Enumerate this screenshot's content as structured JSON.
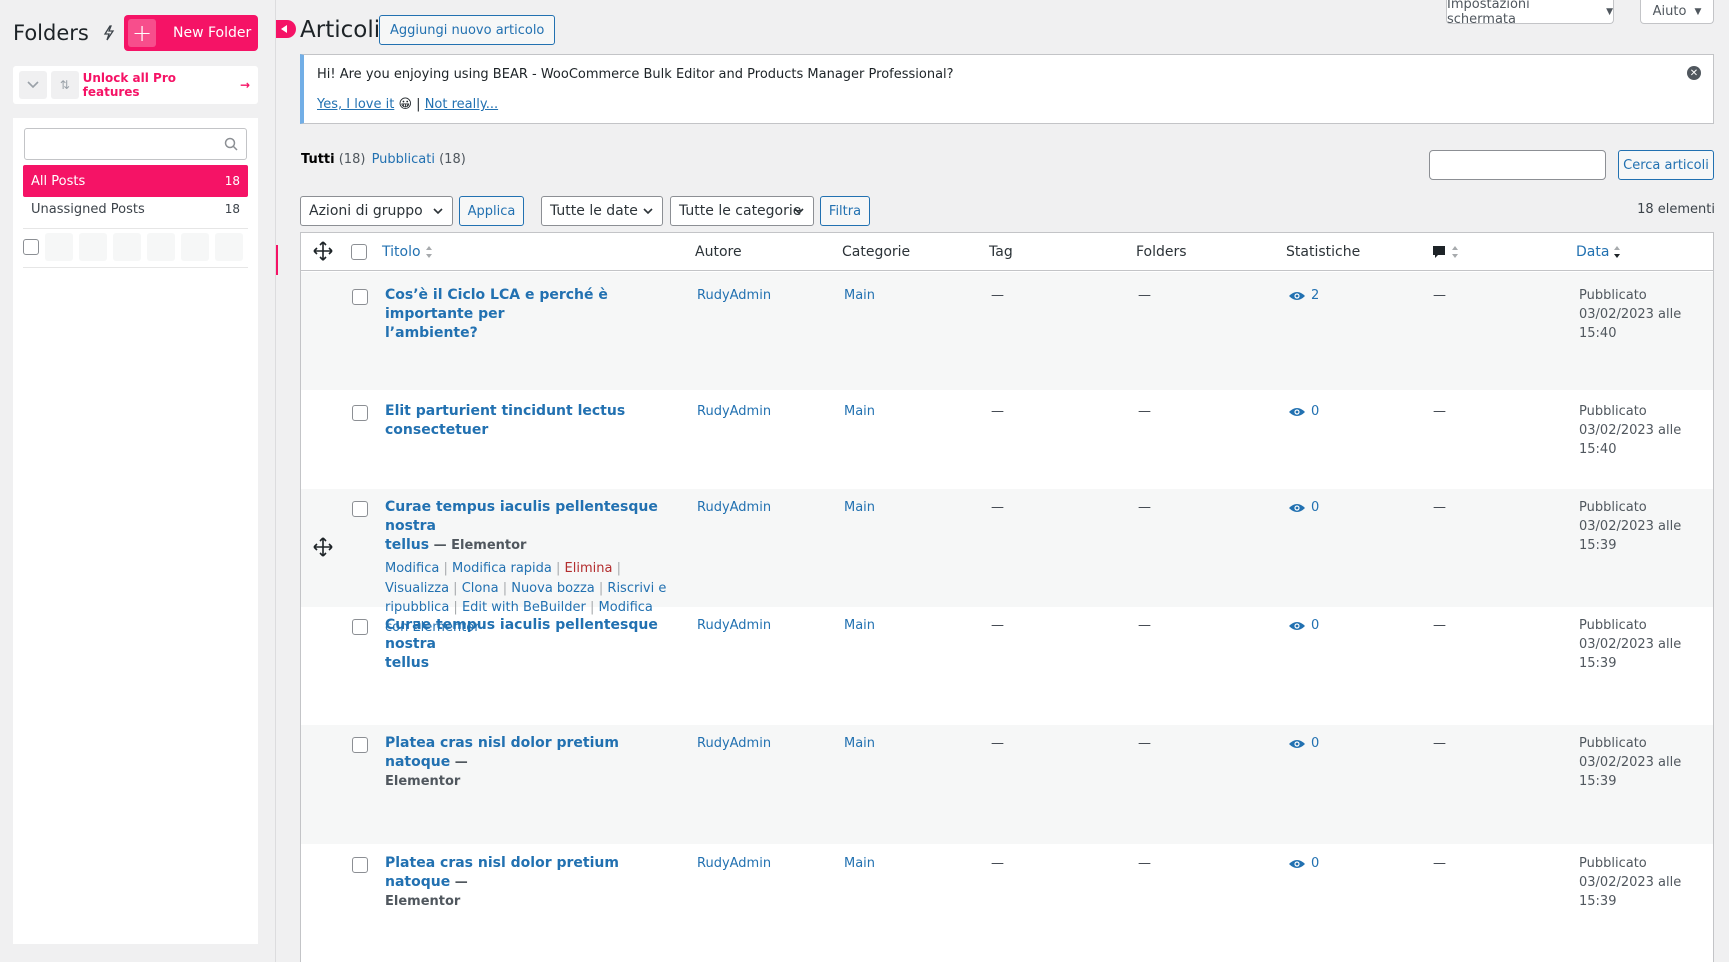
{
  "folders": {
    "title": "Folders",
    "new_folder_label": "New Folder",
    "unlock_label": "Unlock all Pro features",
    "items": [
      {
        "label": "All Posts",
        "count": "18"
      },
      {
        "label": "Unassigned Posts",
        "count": "18"
      }
    ]
  },
  "header": {
    "page_title": "Articoli",
    "add_new_label": "Aggiungi nuovo articolo",
    "screen_options_label": "Impostazioni schermata",
    "help_label": "Aiuto"
  },
  "notice": {
    "text": "Hi! Are you enjoying using BEAR - WooCommerce Bulk Editor and Products Manager Professional?",
    "yes_label": "Yes, I love it",
    "emoji": "😀",
    "separator": "|",
    "no_label": "Not really..."
  },
  "views": {
    "all_label": "Tutti",
    "all_count": "(18)",
    "published_label": "Pubblicati",
    "published_count": "(18)"
  },
  "search": {
    "button_label": "Cerca articoli"
  },
  "filters": {
    "bulk_actions": "Azioni di gruppo",
    "apply_label": "Applica",
    "dates": "Tutte le date",
    "categories": "Tutte le categorie",
    "filter_label": "Filtra",
    "items_count": "18 elementi"
  },
  "table": {
    "columns": {
      "title": "Titolo",
      "author": "Autore",
      "categories": "Categorie",
      "tags": "Tag",
      "folders": "Folders",
      "stats": "Statistiche",
      "date": "Data"
    },
    "dash": "—",
    "row_actions": [
      "Modifica",
      "Modifica rapida",
      "Elimina",
      "Visualizza",
      "Clona",
      "Nuova bozza",
      "Riscrivi e ripubblica",
      "Edit with BeBuilder",
      "Modifica con Elementor"
    ],
    "rows": [
      {
        "title_l1": "Cos’è il Ciclo LCA e perché è importante per",
        "title_l2": "l’ambiente?",
        "state": "",
        "author": "RudyAdmin",
        "category": "Main",
        "views": "2",
        "status": "Pubblicato",
        "date": "03/02/2023 alle 15:40"
      },
      {
        "title_l1": "Elit parturient tincidunt lectus consectetuer",
        "title_l2": "",
        "state": "",
        "author": "RudyAdmin",
        "category": "Main",
        "views": "0",
        "status": "Pubblicato",
        "date": "03/02/2023 alle 15:40"
      },
      {
        "title_l1": "Curae tempus iaculis pellentesque nostra",
        "title_l2": "tellus",
        "state": " — Elementor",
        "author": "RudyAdmin",
        "category": "Main",
        "views": "0",
        "status": "Pubblicato",
        "date": "03/02/2023 alle 15:39"
      },
      {
        "title_l1": "Curae tempus iaculis pellentesque nostra",
        "title_l2": "tellus",
        "state": "",
        "author": "RudyAdmin",
        "category": "Main",
        "views": "0",
        "status": "Pubblicato",
        "date": "03/02/2023 alle 15:39"
      },
      {
        "title_l1": "Platea cras nisl dolor pretium natoque",
        "title_l2": "",
        "state": " —",
        "state2": "Elementor",
        "author": "RudyAdmin",
        "category": "Main",
        "views": "0",
        "status": "Pubblicato",
        "date": "03/02/2023 alle 15:39"
      },
      {
        "title_l1": "Platea cras nisl dolor pretium natoque",
        "title_l2": "",
        "state": " —",
        "state2": "Elementor",
        "author": "RudyAdmin",
        "category": "Main",
        "views": "0",
        "status": "Pubblicato",
        "date": "03/02/2023 alle 15:39"
      }
    ]
  },
  "colors": {
    "accent": "#f51366",
    "link": "#2271b1",
    "notice_border": "#72aee6"
  }
}
